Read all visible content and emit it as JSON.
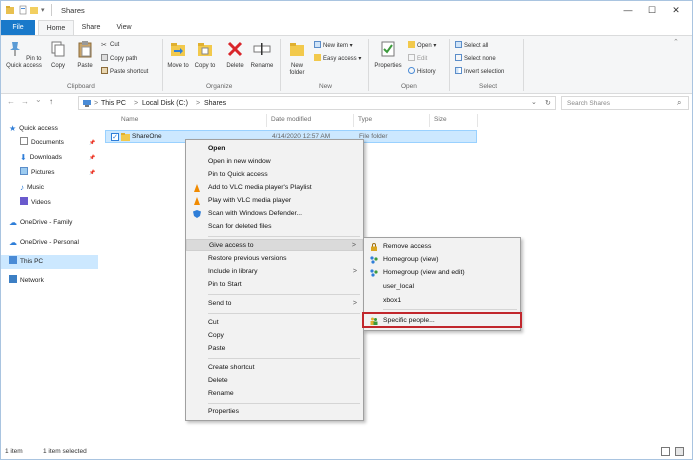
{
  "window": {
    "title": "Shares",
    "controls": {
      "minimize": "—",
      "maximize": "☐",
      "close": "✕"
    }
  },
  "tabs": [
    "File",
    "Home",
    "Share",
    "View"
  ],
  "ribbon": {
    "clipboard": {
      "pin": "Pin to Quick access",
      "copy": "Copy",
      "paste": "Paste",
      "cut": "Cut",
      "copy_path": "Copy path",
      "paste_shortcut": "Paste shortcut",
      "label": "Clipboard"
    },
    "organize": {
      "move_to": "Move to",
      "copy_to": "Copy to",
      "delete": "Delete",
      "rename": "Rename",
      "label": "Organize"
    },
    "new": {
      "new_folder": "New folder",
      "new_item": "New item ▾",
      "easy_access": "Easy access ▾",
      "label": "New"
    },
    "open": {
      "properties": "Properties",
      "open": "Open ▾",
      "edit": "Edit",
      "history": "History",
      "label": "Open"
    },
    "select": {
      "select_all": "Select all",
      "select_none": "Select none",
      "invert": "Invert selection",
      "label": "Select"
    }
  },
  "address": {
    "back": "←",
    "forward": "→",
    "recent": "⌄",
    "up": "↑",
    "crumbs": [
      "This PC",
      "Local Disk (C:)",
      "Shares"
    ],
    "separator": ">",
    "dropdown": "⌄",
    "refresh": "↻",
    "search_placeholder": "Search Shares"
  },
  "nav": {
    "items": [
      {
        "label": "Quick access",
        "icon": "star-icon"
      },
      {
        "label": "Documents",
        "icon": "documents-icon"
      },
      {
        "label": "Downloads",
        "icon": "download-icon"
      },
      {
        "label": "Pictures",
        "icon": "pictures-icon"
      },
      {
        "label": "Music",
        "icon": "music-icon"
      },
      {
        "label": "Videos",
        "icon": "videos-icon"
      },
      {
        "label": "OneDrive - Family",
        "icon": "cloud-icon"
      },
      {
        "label": "OneDrive - Personal",
        "icon": "cloud-icon"
      },
      {
        "label": "This PC",
        "icon": "computer-icon"
      },
      {
        "label": "Network",
        "icon": "network-icon"
      }
    ]
  },
  "columns": [
    "Name",
    "Date modified",
    "Type",
    "Size"
  ],
  "file": {
    "name": "ShareOne",
    "date": "4/14/2020 12:57 AM",
    "type": "File folder"
  },
  "context_menu": {
    "open": "Open",
    "open_new_window": "Open in new window",
    "pin_quick": "Pin to Quick access",
    "vlc_playlist": "Add to VLC media player's Playlist",
    "vlc_play": "Play with VLC media player",
    "defender": "Scan with Windows Defender...",
    "scan_deleted": "Scan for deleted files",
    "give_access": "Give access to",
    "restore": "Restore previous versions",
    "include_library": "Include in library",
    "pin_start": "Pin to Start",
    "send_to": "Send to",
    "cut": "Cut",
    "copy": "Copy",
    "paste": "Paste",
    "create_shortcut": "Create shortcut",
    "delete": "Delete",
    "rename": "Rename",
    "properties": "Properties",
    "arrow": ">"
  },
  "submenu": {
    "remove_access": "Remove access",
    "homegroup_view": "Homegroup (view)",
    "homegroup_view_edit": "Homegroup (view and edit)",
    "user_local": "user_local",
    "xbox1": "xbox1",
    "specific_people": "Specific people..."
  },
  "status": {
    "items": "1 item",
    "selected": "1 item selected"
  },
  "colors": {
    "accent": "#1979ca",
    "selection": "#cce8ff",
    "highlight_box": "#c1272d"
  }
}
